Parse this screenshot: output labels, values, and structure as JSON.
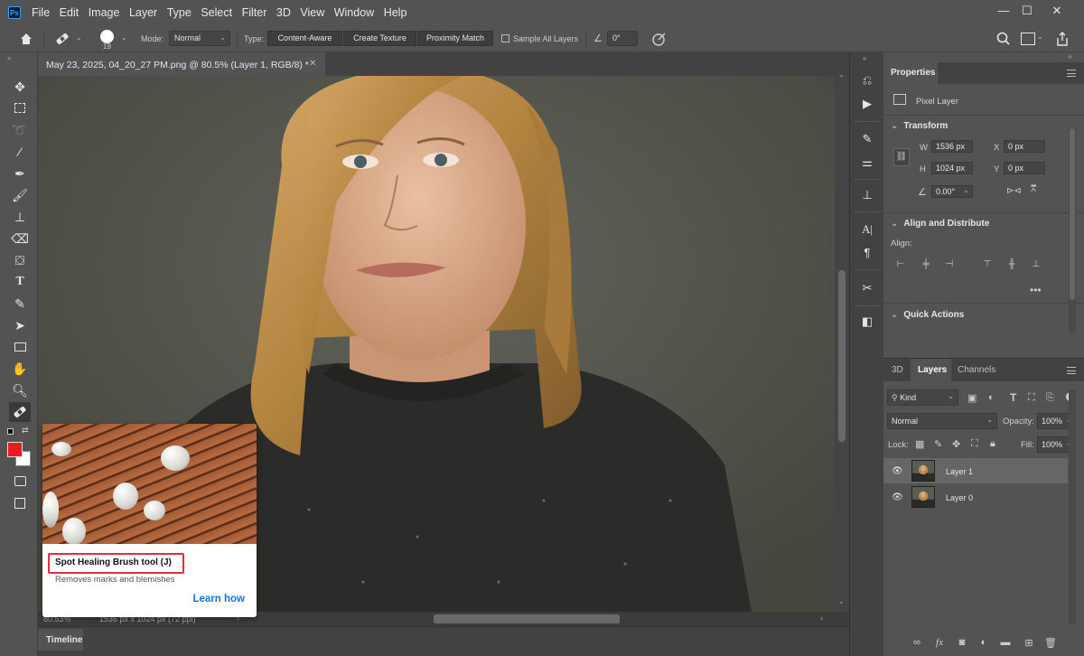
{
  "app": {
    "logo_text": "Ps",
    "accent": "#31a8ff"
  },
  "menu": [
    "File",
    "Edit",
    "Image",
    "Layer",
    "Type",
    "Select",
    "Filter",
    "3D",
    "View",
    "Window",
    "Help"
  ],
  "window_controls": {
    "minimize": "—",
    "maximize": "☐",
    "close": "✕"
  },
  "options_bar": {
    "brush_size": "19",
    "mode_label": "Mode:",
    "mode_value": "Normal",
    "type_label": "Type:",
    "type_buttons": [
      "Content-Aware",
      "Create Texture",
      "Proximity Match"
    ],
    "sample_all_layers": "Sample All Layers",
    "angle_value": "0°"
  },
  "document": {
    "tab_title": "May 23, 2025, 04_20_27 PM.png @ 80.5% (Layer 1, RGB/8) *",
    "zoom": "80.53%",
    "size_info": "1536 px x 1024 px (72 ppi)"
  },
  "tooltip": {
    "title": "Spot Healing Brush tool (J)",
    "description": "Removes marks and blemishes",
    "learn_link": "Learn how",
    "highlight_color": "#e0303e",
    "link_color": "#1473e6"
  },
  "timeline": {
    "label": "Timeline"
  },
  "properties": {
    "tab": "Properties",
    "layer_type": "Pixel Layer",
    "transform": {
      "heading": "Transform",
      "w_label": "W",
      "w_value": "1536 px",
      "h_label": "H",
      "h_value": "1024 px",
      "x_label": "X",
      "x_value": "0 px",
      "y_label": "Y",
      "y_value": "0 px",
      "angle_value": "0.00°"
    },
    "align": {
      "heading": "Align and Distribute",
      "label": "Align:"
    },
    "quick_actions": {
      "heading": "Quick Actions"
    }
  },
  "layers_panel": {
    "tabs": [
      "3D",
      "Layers",
      "Channels"
    ],
    "filter_kind": "Kind",
    "blend_mode": "Normal",
    "opacity_label": "Opacity:",
    "opacity_value": "100%",
    "lock_label": "Lock:",
    "fill_label": "Fill:",
    "fill_value": "100%",
    "layers": [
      {
        "name": "Layer 1",
        "selected": true
      },
      {
        "name": "Layer 0",
        "selected": false
      }
    ]
  },
  "colors": {
    "foreground": "#e81c1c",
    "background": "#ffffff"
  }
}
